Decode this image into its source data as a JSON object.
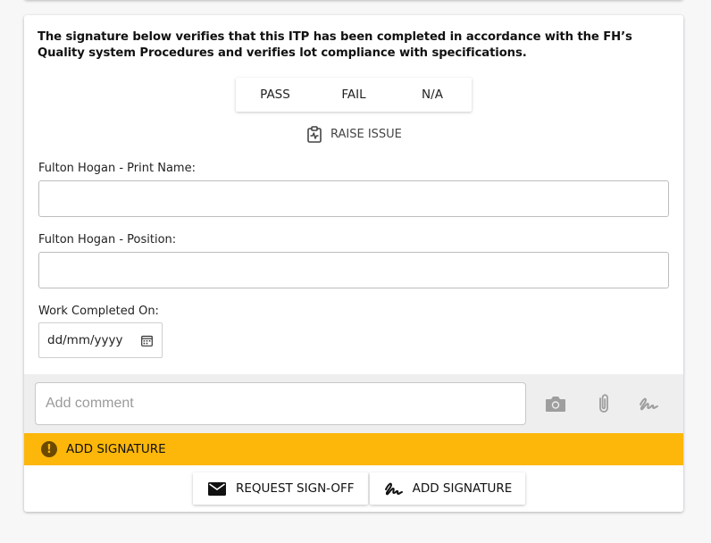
{
  "statement": "The signature below verifies that this ITP has been completed in accordance with the FH’s Quality system Procedures and verifies lot compliance with specifications.",
  "result_options": [
    "PASS",
    "FAIL",
    "N/A"
  ],
  "raise_issue": {
    "label": "RAISE ISSUE",
    "icon": "clipboard-pulse-icon"
  },
  "fields": {
    "print_name": {
      "label": "Fulton Hogan - Print Name:",
      "value": ""
    },
    "position": {
      "label": "Fulton Hogan - Position:",
      "value": ""
    },
    "work_completed": {
      "label": "Work Completed On:",
      "placeholder": "dd/mm/yyyy"
    }
  },
  "comment": {
    "placeholder": "Add comment",
    "icons": [
      "camera-icon",
      "paperclip-icon",
      "signature-icon"
    ]
  },
  "signature_banner": {
    "label": "ADD SIGNATURE",
    "icon": "exclamation-icon"
  },
  "actions": {
    "request_signoff": {
      "label": "REQUEST SIGN-OFF",
      "icon": "envelope-icon"
    },
    "add_signature": {
      "label": "ADD SIGNATURE",
      "icon": "signature-icon"
    }
  },
  "colors": {
    "banner": "#fcb70a",
    "comment_bar": "#eeeeee"
  }
}
